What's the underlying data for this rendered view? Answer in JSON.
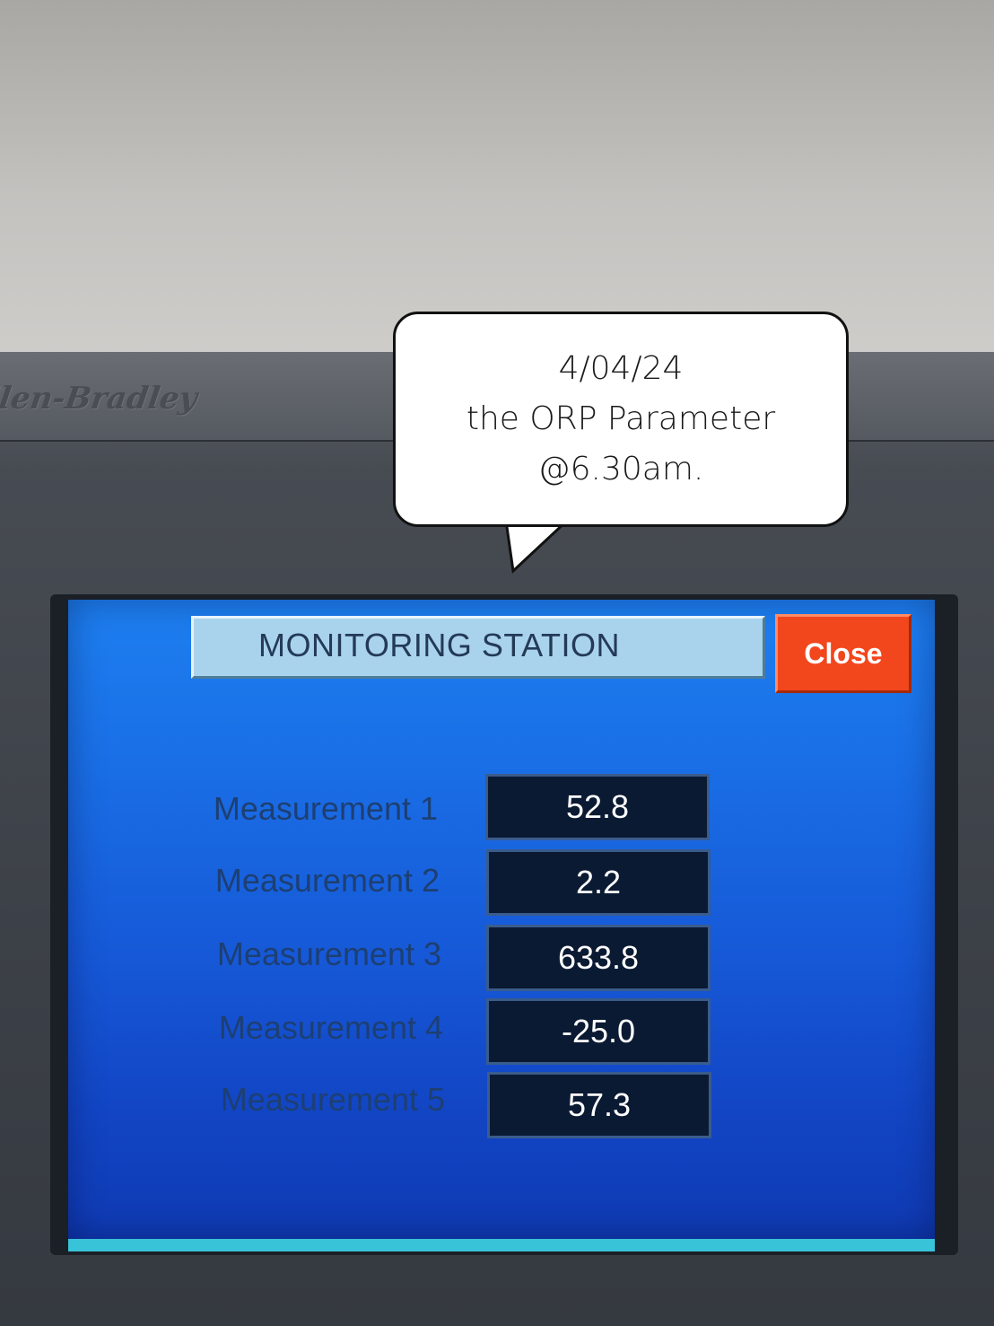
{
  "device": {
    "brand": "Allen-Bradley"
  },
  "annotation": {
    "line1": "4/04/24",
    "line2": "the ORP Parameter",
    "line3": "@6.30am."
  },
  "hmi": {
    "title": "MONITORING STATION",
    "close_label": "Close",
    "measurements": [
      {
        "label": "Measurement 1",
        "value": "52.8"
      },
      {
        "label": "Measurement 2",
        "value": "2.2"
      },
      {
        "label": "Measurement 3",
        "value": "633.8"
      },
      {
        "label": "Measurement 4",
        "value": "-25.0"
      },
      {
        "label": "Measurement 5",
        "value": "57.3"
      }
    ]
  },
  "colors": {
    "screen_blue": "#1a6fe6",
    "title_bar": "#a9d3ec",
    "close_button": "#f2471d",
    "value_box": "#0b1a33"
  }
}
